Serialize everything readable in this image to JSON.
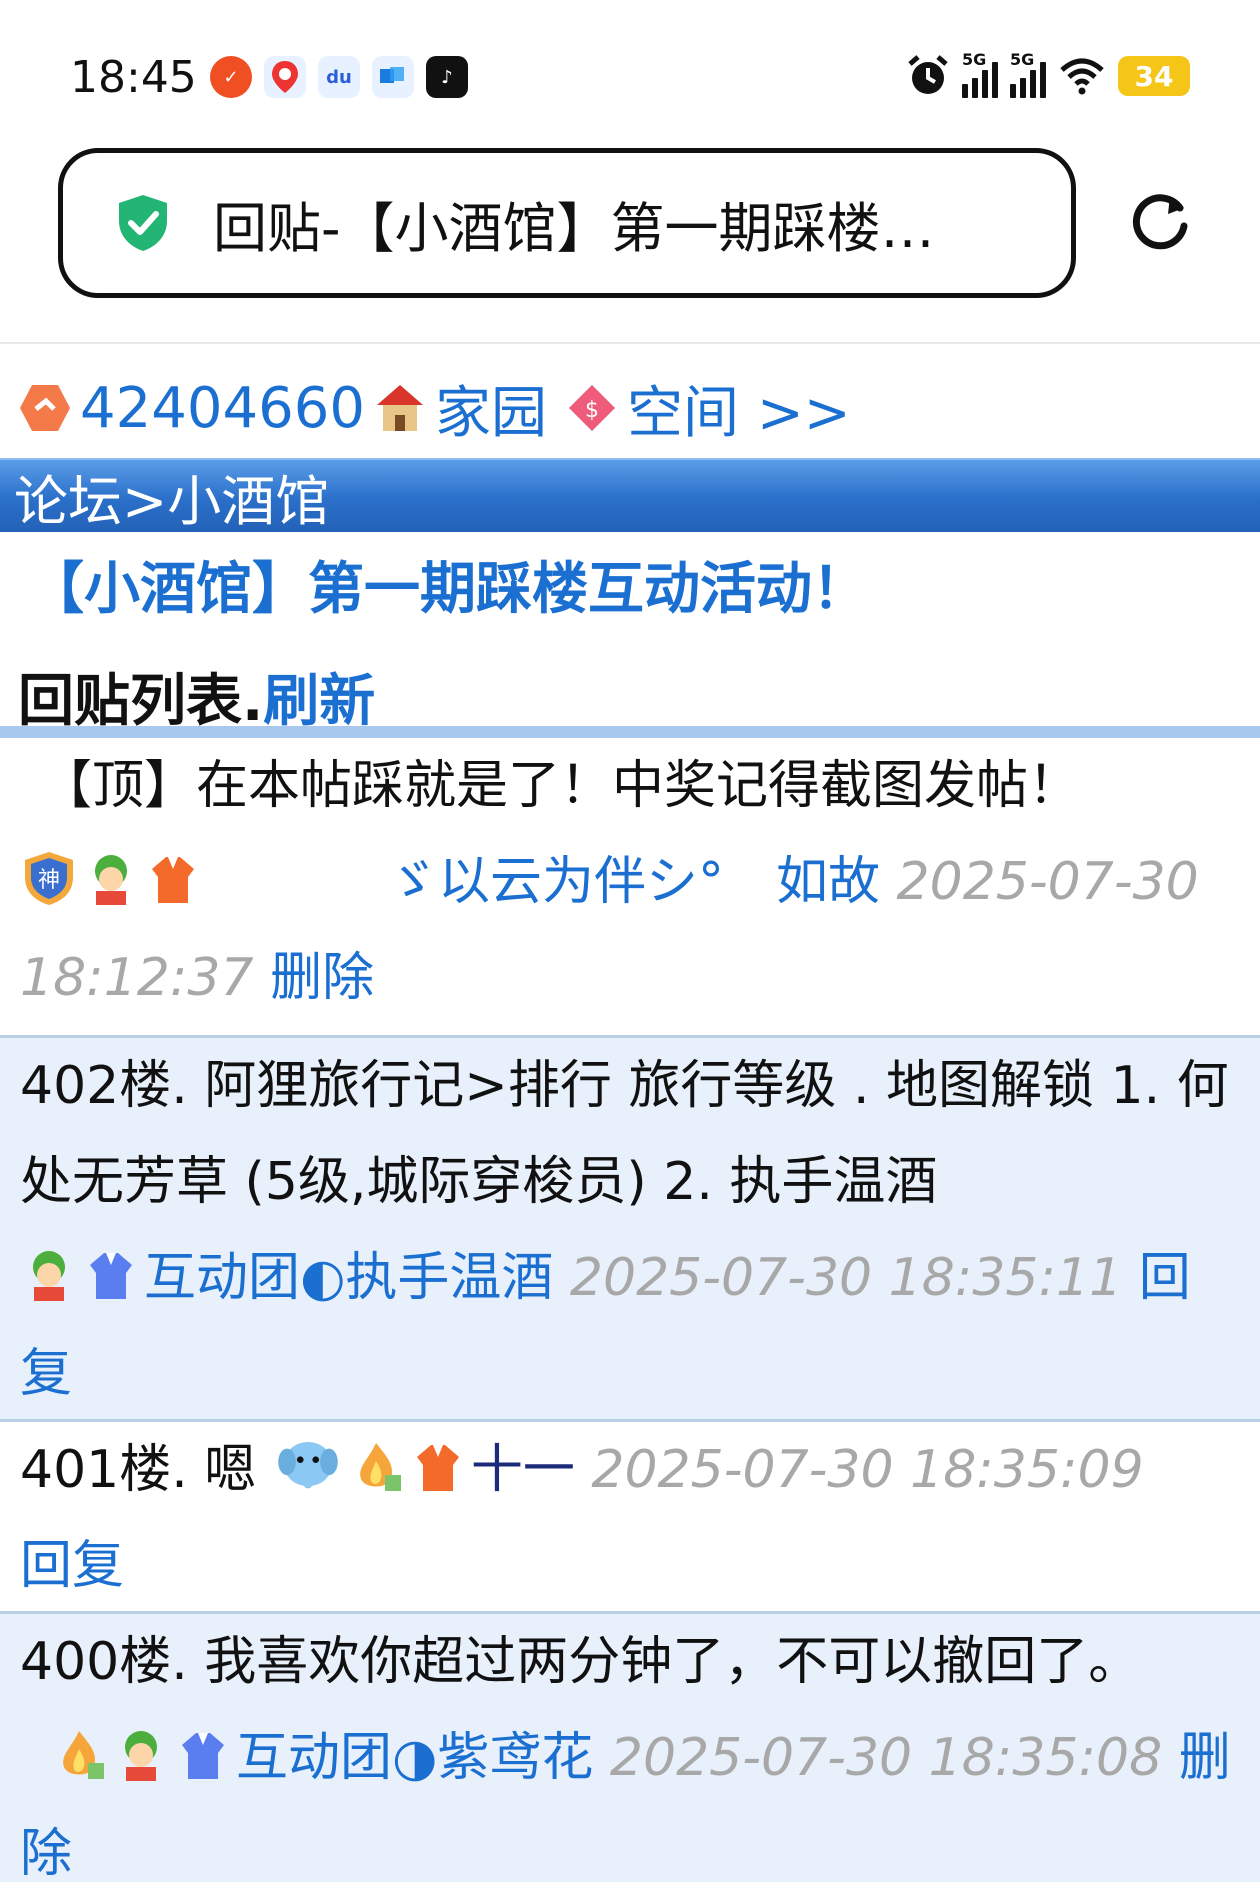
{
  "status_bar": {
    "time": "18:45",
    "app_icons": [
      "app-icon-orange",
      "app-icon-map",
      "app-icon-baidu",
      "app-icon-blue",
      "app-icon-tiktok"
    ],
    "signal_1": "5G",
    "signal_2": "5G",
    "battery": "34"
  },
  "browser": {
    "url_title": "回贴-【小酒馆】第一期踩楼…"
  },
  "forum": {
    "user_id": "42404660",
    "home_link": "家园",
    "space_link": "空间 >>",
    "breadcrumb": "论坛>小酒馆",
    "thread_title": "【小酒馆】第一期踩楼互动活动！",
    "reply_list_label": "回贴列表.",
    "refresh_label": "刷新"
  },
  "posts": [
    {
      "text": "【顶】在本帖踩就是了！中奖记得截图发帖！",
      "nick": "ゞ以云为伴シ°　如故",
      "timestamp": "2025-07-30 18:12:37",
      "action": "删除"
    },
    {
      "text": "402楼. 阿狸旅行记>排行 旅行等级 . 地图解锁 1. 何处无芳草 ￼(5级,城际穿梭员) 2. 执手温酒",
      "nick": "互动团◐执手温酒",
      "timestamp": "2025-07-30 18:35:11",
      "action": "回复"
    },
    {
      "text": "401楼. 嗯",
      "nick": "十一",
      "timestamp": "2025-07-30 18:35:09",
      "action": "回复"
    },
    {
      "text": "400楼. 我喜欢你超过两分钟了，不可以撤回了。",
      "nick": "互动团◑紫鸢花",
      "timestamp": "2025-07-30 18:35:08",
      "action": "删除"
    }
  ],
  "colors": {
    "link_blue": "#1a6fd1",
    "header_blue": "#2a6fc9",
    "alt_row": "#e8f0fb",
    "timestamp_gray": "#a8a8a8",
    "battery_yellow": "#f5c518"
  }
}
